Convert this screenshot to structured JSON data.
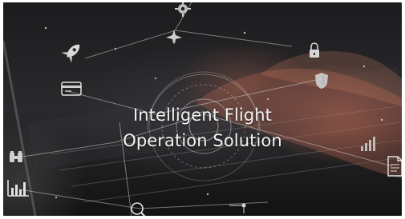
{
  "hero": {
    "title_line1": "Intelligent Flight",
    "title_line2": "Operation Solution"
  },
  "colors": {
    "background_dark": "#1c1b1d",
    "title_text": "#f3f3f3",
    "icon_gray": "#cfcfcf",
    "warm_skin": "#d2785f"
  },
  "icons": [
    "rocket-icon",
    "plane-icon",
    "gear-icon",
    "card-icon",
    "lock-icon",
    "shield-icon",
    "binoculars-icon",
    "bar-chart-icon",
    "signal-bars-icon",
    "document-icon",
    "search-icon",
    "circuit-icon"
  ]
}
